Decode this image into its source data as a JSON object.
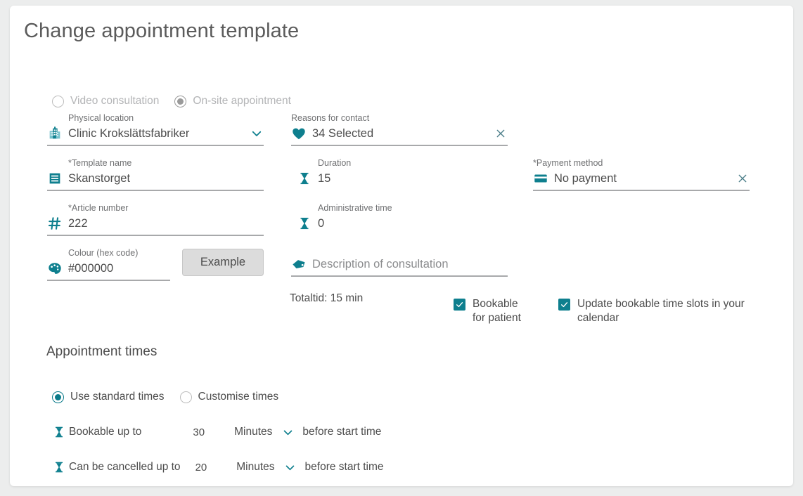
{
  "page": {
    "title": "Change appointment template",
    "accent_teal": "#0e7f8e",
    "background": "#eceded",
    "card_background": "#ffffff"
  },
  "appointment_type": {
    "options": [
      {
        "label": "Video consultation",
        "selected": false,
        "icon": "radio-unselected-icon"
      },
      {
        "label": "On-site appointment",
        "selected": true,
        "icon": "radio-selected-icon"
      }
    ]
  },
  "fields": {
    "physical_location": {
      "label": "Physical location",
      "value": "Clinic Krokslättsfabriker",
      "icon": "building-icon",
      "trailing_icon": "chevron-down-icon"
    },
    "reasons_for_contact": {
      "label": "Reasons for contact",
      "value": "34 Selected",
      "icon": "heart-icon",
      "trailing_icon": "close-icon"
    },
    "template_name": {
      "label": "*Template name",
      "value": "Skanstorget",
      "icon": "list-icon"
    },
    "duration": {
      "label": "Duration",
      "value": "15",
      "icon": "hourglass-icon"
    },
    "payment_method": {
      "label": "*Payment method",
      "value": "No payment",
      "icon": "credit-card-icon",
      "trailing_icon": "close-icon"
    },
    "article_number": {
      "label": "*Article number",
      "value": "222",
      "icon": "hash-icon"
    },
    "administrative_time": {
      "label": "Administrative time",
      "value": "0",
      "icon": "hourglass-icon"
    },
    "colour_hex": {
      "label": "Colour (hex code)",
      "value": "#000000",
      "icon": "palette-icon"
    },
    "description": {
      "label": "",
      "placeholder": "Description of consultation",
      "value": "",
      "icon": "tag-icon"
    }
  },
  "example_button": {
    "label": "Example"
  },
  "total_time": {
    "text": "Totaltid: 15 min"
  },
  "checkboxes": [
    {
      "label": "Bookable for patient",
      "checked": true
    },
    {
      "label": "Update bookable time slots in your calendar",
      "checked": true
    }
  ],
  "appointment_times": {
    "section_title": "Appointment times",
    "mode_options": [
      {
        "label": "Use standard times",
        "selected": true
      },
      {
        "label": "Customise times",
        "selected": false
      }
    ],
    "rows": [
      {
        "label": "Bookable up to",
        "value": "30",
        "unit": "Minutes",
        "suffix": "before start time",
        "icon": "hourglass-icon",
        "trailing_icon": "chevron-down-icon"
      },
      {
        "label": "Can be cancelled up to",
        "value": "20",
        "unit": "Minutes",
        "suffix": "before start time",
        "icon": "hourglass-icon",
        "trailing_icon": "chevron-down-icon"
      }
    ]
  }
}
